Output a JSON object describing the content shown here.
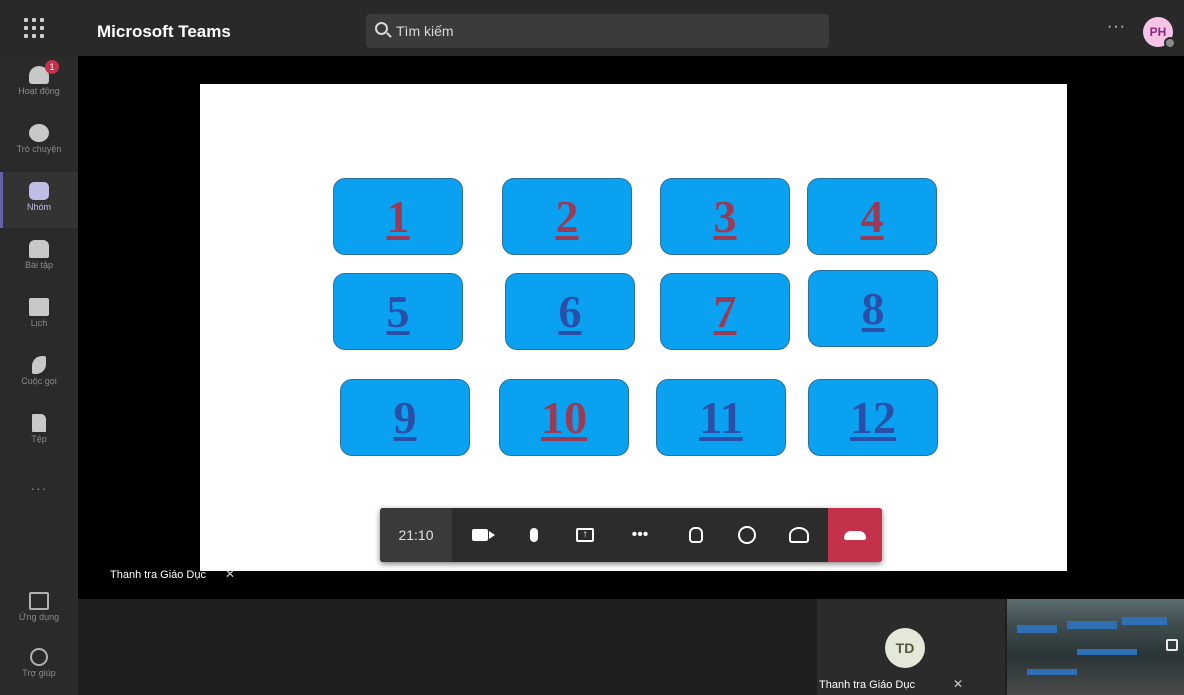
{
  "topbar": {
    "app_title": "Microsoft Teams",
    "search_placeholder": "Tìm kiếm",
    "more_label": "···",
    "avatar_initials": "PH"
  },
  "rail": {
    "items": [
      {
        "label": "Hoạt động",
        "icon": "bell-icon",
        "badge": "1"
      },
      {
        "label": "Trò chuyện",
        "icon": "chat-icon"
      },
      {
        "label": "Nhóm",
        "icon": "teams-icon",
        "active": true
      },
      {
        "label": "Bài tập",
        "icon": "assignments-icon"
      },
      {
        "label": "Lịch",
        "icon": "calendar-icon"
      },
      {
        "label": "Cuộc gọi",
        "icon": "phone-icon"
      },
      {
        "label": "Tệp",
        "icon": "file-icon"
      }
    ],
    "more": "···",
    "apps_label": "Ứng dụng",
    "help_label": "Trợ giúp"
  },
  "slide": {
    "tiles": [
      "1",
      "2",
      "3",
      "4",
      "5",
      "6",
      "7",
      "8",
      "9",
      "10",
      "11",
      "12"
    ],
    "tile_color": "#0aa2f0",
    "visited_color": "#9b3a55",
    "link_color": "#2a4fa8"
  },
  "stage": {
    "presenter_name": "Thanh tra Giáo Dục"
  },
  "controls": {
    "timer": "21:10",
    "hangup_color": "#c4314b"
  },
  "participants": {
    "td_initials": "TD",
    "td_name": "Thanh tra Giáo Dục"
  }
}
